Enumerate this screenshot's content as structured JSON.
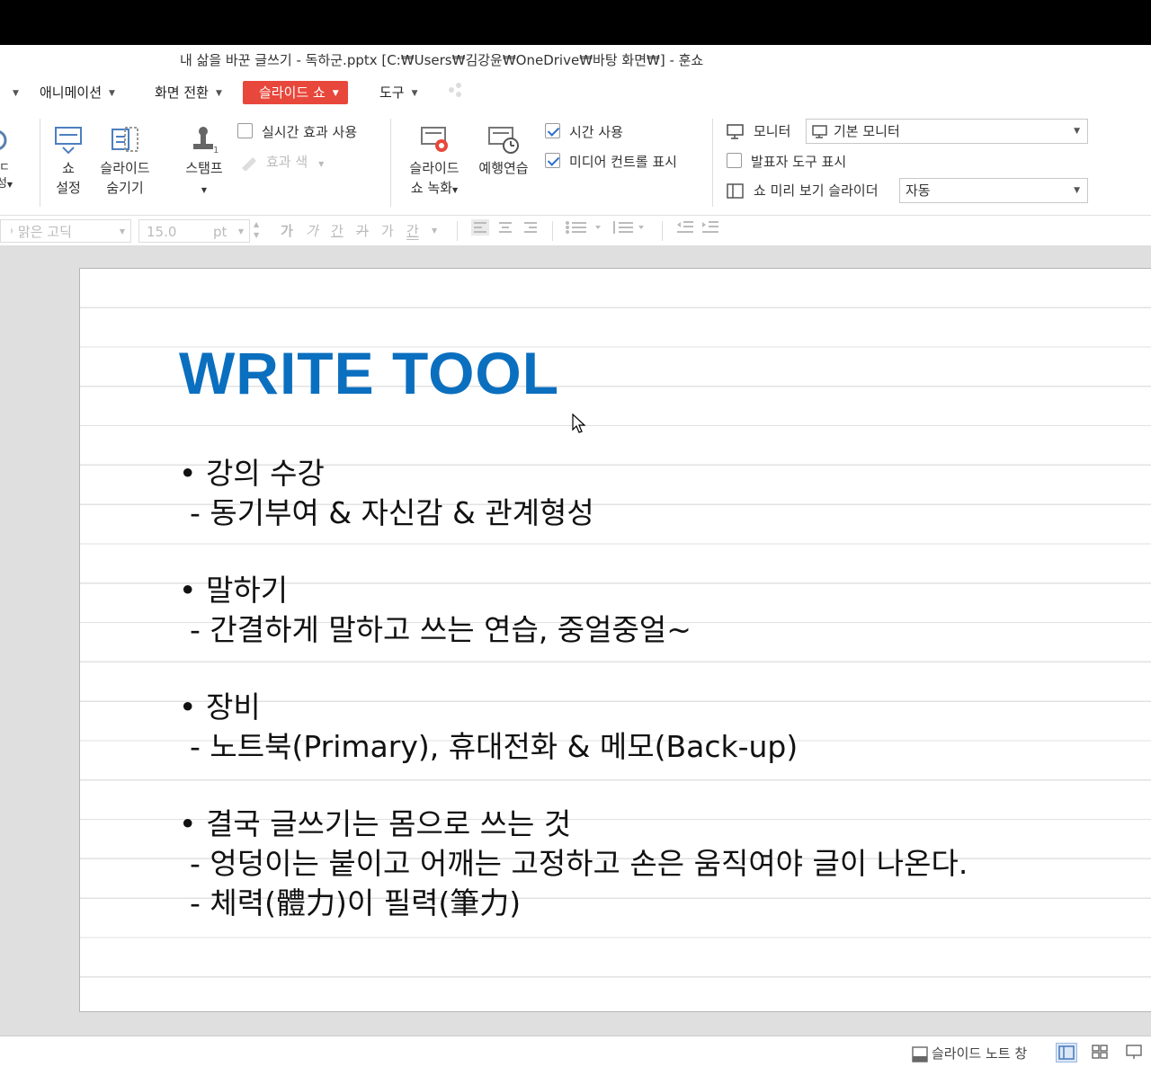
{
  "window": {
    "title": "내 삶을 바꾼 글쓰기 - 독하군.pptx [C:₩Users₩김강윤₩OneDrive₩바탕 화면₩] - 훈쇼"
  },
  "menu": {
    "items": [
      {
        "label": "애니메이션"
      },
      {
        "label": "화면 전환"
      },
      {
        "label": "슬라이드 쇼"
      },
      {
        "label": "도구"
      }
    ]
  },
  "ribbon": {
    "cut_left_1": "ㄷ",
    "cut_left_2": "성",
    "show_settings": "쇼\n설정",
    "show_settings_l1": "쇼",
    "show_settings_l2": "설정",
    "hide_slide_l1": "슬라이드",
    "hide_slide_l2": "숨기기",
    "stamp": "스탬프",
    "realtime_effect": "실시간 효과 사용",
    "effect_color": "효과 색",
    "record_l1": "슬라이드",
    "record_l2": "쇼 녹화",
    "rehearse": "예행연습",
    "use_timing": "시간 사용",
    "show_media_controls": "미디어 컨트롤 표시",
    "monitor_label": "모니터",
    "monitor_value": "기본 모니터",
    "presenter_tools": "발표자 도구 표시",
    "preview_slider_label": "쇼 미리 보기 슬라이더",
    "preview_slider_value": "자동"
  },
  "format": {
    "font": "맑은 고딕",
    "size": "15.0",
    "unit": "pt",
    "styles": [
      "가",
      "가",
      "간",
      "가",
      "가",
      "간"
    ]
  },
  "slide": {
    "title": "WRITE TOOL",
    "lines": {
      "b1": "강의 수강",
      "b1s1": "- 동기부여 & 자신감 & 관계형성",
      "b2": "말하기",
      "b2s1": "- 간결하게 말하고 쓰는 연습, 중얼중얼~",
      "b3": "장비",
      "b3s1": "- 노트북(Primary), 휴대전화 & 메모(Back-up)",
      "b4": "결국 글쓰기는 몸으로 쓰는 것",
      "b4s1": "- 엉덩이는 붙이고 어깨는 고정하고 손은 움직여야 글이 나온다.",
      "b4s2": "- 체력(體力)이 필력(筆力)"
    }
  },
  "status": {
    "notes_pane": "슬라이드 노트 창"
  },
  "colors": {
    "accent": "#e8473b",
    "title_blue": "#0b6fbf"
  }
}
